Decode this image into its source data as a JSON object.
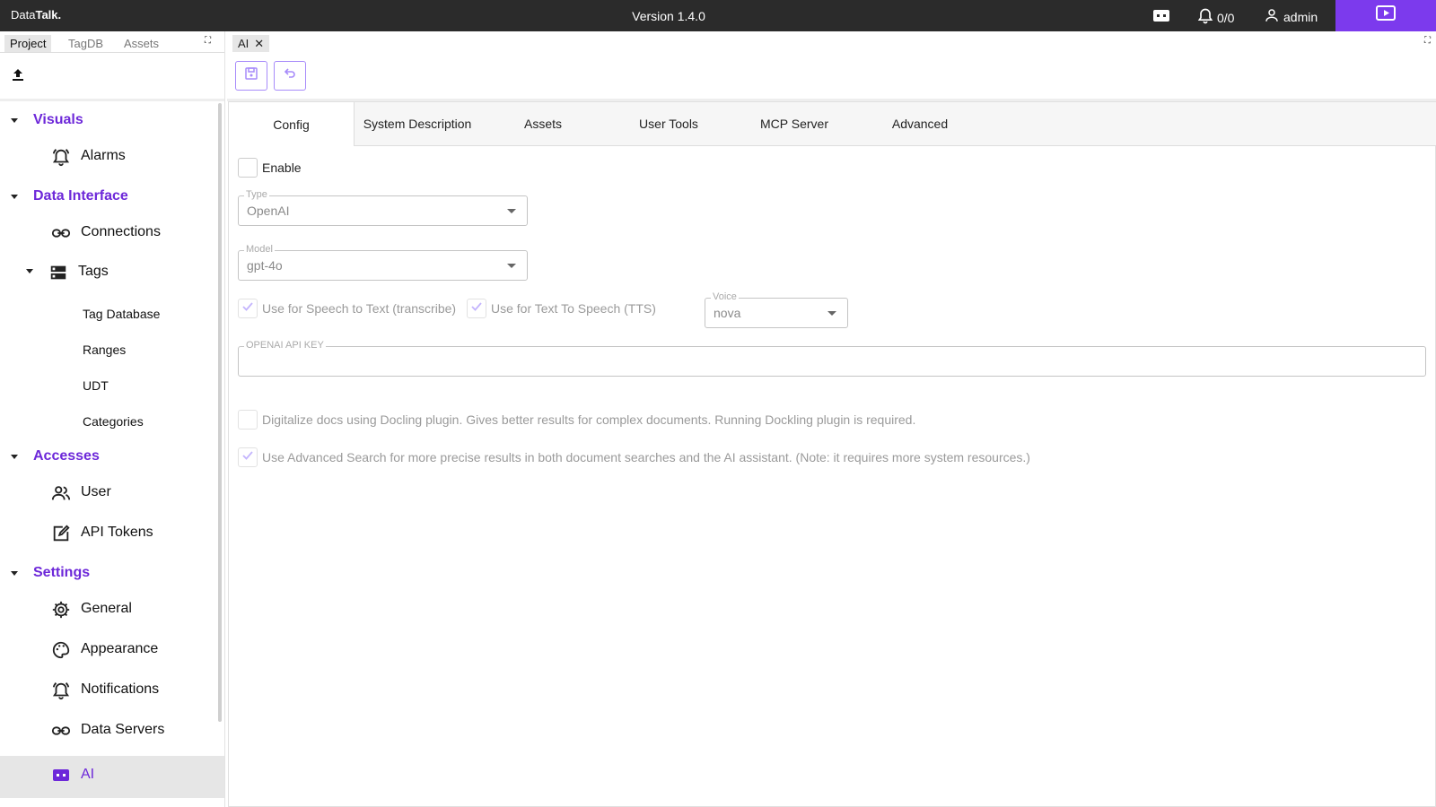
{
  "app": {
    "logo_prefix": "Data",
    "logo_suffix": "Talk.",
    "version": "Version 1.4.0",
    "alarm_count": "0/0",
    "user": "admin",
    "accent": "#7c3aed"
  },
  "left_tabs": [
    "Project",
    "TagDB",
    "Assets"
  ],
  "tree": {
    "visuals": {
      "label": "Visuals",
      "alarms": "Alarms"
    },
    "data_interface": {
      "label": "Data Interface",
      "connections": "Connections",
      "tags": "Tags",
      "tag_database": "Tag Database",
      "ranges": "Ranges",
      "udt": "UDT",
      "categories": "Categories"
    },
    "accesses": {
      "label": "Accesses",
      "user": "User",
      "api_tokens": "API Tokens"
    },
    "settings": {
      "label": "Settings",
      "general": "General",
      "appearance": "Appearance",
      "notifications": "Notifications",
      "data_servers": "Data Servers",
      "ai": "AI"
    }
  },
  "editor_tab": "AI",
  "tabs": [
    "Config",
    "System Description",
    "Assets",
    "User Tools",
    "MCP Server",
    "Advanced"
  ],
  "config": {
    "enable_label": "Enable",
    "type": {
      "label": "Type",
      "value": "OpenAI"
    },
    "model": {
      "label": "Model",
      "value": "gpt-4o"
    },
    "stt_label": "Use for Speech to Text (transcribe)",
    "tts_label": "Use for Text To Speech (TTS)",
    "voice": {
      "label": "Voice",
      "value": "nova"
    },
    "api_key": {
      "label": "OPENAI API KEY",
      "value": ""
    },
    "docling_label": "Digitalize docs using Docling plugin. Gives better results for complex documents. Running Dockling plugin is required.",
    "adv_search_label": "Use Advanced Search for more precise results in both document searches and the AI assistant. (Note: it requires more system resources.)"
  }
}
